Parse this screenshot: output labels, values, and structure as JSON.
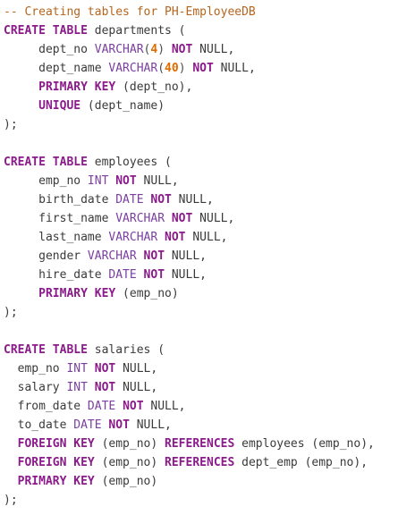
{
  "editor": {
    "lines": [
      [
        {
          "t": "-- Creating tables for PH-EmployeeDB",
          "c": "comment"
        }
      ],
      [
        {
          "t": "CREATE TABLE",
          "c": "kw"
        },
        {
          "t": " departments (",
          "c": "plain"
        }
      ],
      [
        {
          "t": "     dept_no ",
          "c": "plain"
        },
        {
          "t": "VARCHAR",
          "c": "type"
        },
        {
          "t": "(",
          "c": "punc"
        },
        {
          "t": "4",
          "c": "num"
        },
        {
          "t": ") ",
          "c": "punc"
        },
        {
          "t": "NOT",
          "c": "kw"
        },
        {
          "t": " NULL,",
          "c": "plain"
        }
      ],
      [
        {
          "t": "     dept_name ",
          "c": "plain"
        },
        {
          "t": "VARCHAR",
          "c": "type"
        },
        {
          "t": "(",
          "c": "punc"
        },
        {
          "t": "40",
          "c": "num"
        },
        {
          "t": ") ",
          "c": "punc"
        },
        {
          "t": "NOT",
          "c": "kw"
        },
        {
          "t": " NULL,",
          "c": "plain"
        }
      ],
      [
        {
          "t": "     ",
          "c": "plain"
        },
        {
          "t": "PRIMARY KEY",
          "c": "kw"
        },
        {
          "t": " (dept_no),",
          "c": "plain"
        }
      ],
      [
        {
          "t": "     ",
          "c": "plain"
        },
        {
          "t": "UNIQUE",
          "c": "kw"
        },
        {
          "t": " (dept_name)",
          "c": "plain"
        }
      ],
      [
        {
          "t": ");",
          "c": "plain"
        }
      ],
      [
        {
          "t": "",
          "c": "plain"
        }
      ],
      [
        {
          "t": "CREATE TABLE",
          "c": "kw"
        },
        {
          "t": " employees (",
          "c": "plain"
        }
      ],
      [
        {
          "t": "     emp_no ",
          "c": "plain"
        },
        {
          "t": "INT",
          "c": "type"
        },
        {
          "t": " ",
          "c": "plain"
        },
        {
          "t": "NOT",
          "c": "kw"
        },
        {
          "t": " NULL,",
          "c": "plain"
        }
      ],
      [
        {
          "t": "     birth_date ",
          "c": "plain"
        },
        {
          "t": "DATE",
          "c": "type"
        },
        {
          "t": " ",
          "c": "plain"
        },
        {
          "t": "NOT",
          "c": "kw"
        },
        {
          "t": " NULL,",
          "c": "plain"
        }
      ],
      [
        {
          "t": "     first_name ",
          "c": "plain"
        },
        {
          "t": "VARCHAR",
          "c": "type"
        },
        {
          "t": " ",
          "c": "plain"
        },
        {
          "t": "NOT",
          "c": "kw"
        },
        {
          "t": " NULL,",
          "c": "plain"
        }
      ],
      [
        {
          "t": "     last_name ",
          "c": "plain"
        },
        {
          "t": "VARCHAR",
          "c": "type"
        },
        {
          "t": " ",
          "c": "plain"
        },
        {
          "t": "NOT",
          "c": "kw"
        },
        {
          "t": " NULL,",
          "c": "plain"
        }
      ],
      [
        {
          "t": "     gender ",
          "c": "plain"
        },
        {
          "t": "VARCHAR",
          "c": "type"
        },
        {
          "t": " ",
          "c": "plain"
        },
        {
          "t": "NOT",
          "c": "kw"
        },
        {
          "t": " NULL,",
          "c": "plain"
        }
      ],
      [
        {
          "t": "     hire_date ",
          "c": "plain"
        },
        {
          "t": "DATE",
          "c": "type"
        },
        {
          "t": " ",
          "c": "plain"
        },
        {
          "t": "NOT",
          "c": "kw"
        },
        {
          "t": " NULL,",
          "c": "plain"
        }
      ],
      [
        {
          "t": "     ",
          "c": "plain"
        },
        {
          "t": "PRIMARY KEY",
          "c": "kw"
        },
        {
          "t": " (emp_no)",
          "c": "plain"
        }
      ],
      [
        {
          "t": ");",
          "c": "plain"
        }
      ],
      [
        {
          "t": "",
          "c": "plain"
        }
      ],
      [
        {
          "t": "CREATE TABLE",
          "c": "kw"
        },
        {
          "t": " salaries (",
          "c": "plain"
        }
      ],
      [
        {
          "t": "  emp_no ",
          "c": "plain"
        },
        {
          "t": "INT",
          "c": "type"
        },
        {
          "t": " ",
          "c": "plain"
        },
        {
          "t": "NOT",
          "c": "kw"
        },
        {
          "t": " NULL,",
          "c": "plain"
        }
      ],
      [
        {
          "t": "  salary ",
          "c": "plain"
        },
        {
          "t": "INT",
          "c": "type"
        },
        {
          "t": " ",
          "c": "plain"
        },
        {
          "t": "NOT",
          "c": "kw"
        },
        {
          "t": " NULL,",
          "c": "plain"
        }
      ],
      [
        {
          "t": "  from_date ",
          "c": "plain"
        },
        {
          "t": "DATE",
          "c": "type"
        },
        {
          "t": " ",
          "c": "plain"
        },
        {
          "t": "NOT",
          "c": "kw"
        },
        {
          "t": " NULL,",
          "c": "plain"
        }
      ],
      [
        {
          "t": "  to_date ",
          "c": "plain"
        },
        {
          "t": "DATE",
          "c": "type"
        },
        {
          "t": " ",
          "c": "plain"
        },
        {
          "t": "NOT",
          "c": "kw"
        },
        {
          "t": " NULL,",
          "c": "plain"
        }
      ],
      [
        {
          "t": "  ",
          "c": "plain"
        },
        {
          "t": "FOREIGN KEY",
          "c": "kw"
        },
        {
          "t": " (emp_no) ",
          "c": "plain"
        },
        {
          "t": "REFERENCES",
          "c": "kw"
        },
        {
          "t": " employees (emp_no),",
          "c": "plain"
        }
      ],
      [
        {
          "t": "  ",
          "c": "plain"
        },
        {
          "t": "FOREIGN KEY",
          "c": "kw"
        },
        {
          "t": " (emp_no) ",
          "c": "plain"
        },
        {
          "t": "REFERENCES",
          "c": "kw"
        },
        {
          "t": " dept_emp (emp_no),",
          "c": "plain"
        }
      ],
      [
        {
          "t": "  ",
          "c": "plain"
        },
        {
          "t": "PRIMARY KEY",
          "c": "kw"
        },
        {
          "t": " (emp_no)",
          "c": "plain"
        }
      ],
      [
        {
          "t": ");",
          "c": "plain"
        }
      ]
    ]
  },
  "colors": {
    "comment": "#b5651d",
    "keyword": "#8b1a8b",
    "type": "#7a3fa0",
    "number": "#e06c00",
    "text": "#3a3a3a",
    "background": "#ffffff"
  }
}
